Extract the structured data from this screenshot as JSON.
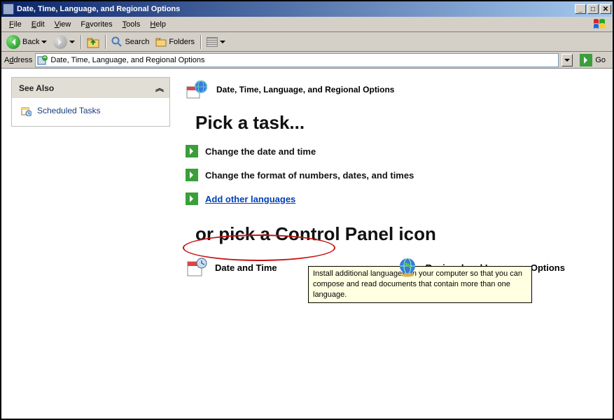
{
  "window": {
    "title": "Date, Time, Language, and Regional Options"
  },
  "menubar": {
    "file": "File",
    "edit": "Edit",
    "view": "View",
    "favorites": "Favorites",
    "tools": "Tools",
    "help": "Help"
  },
  "toolbar": {
    "back": "Back",
    "search": "Search",
    "folders": "Folders"
  },
  "addressbar": {
    "label": "Address",
    "value": "Date, Time, Language, and Regional Options",
    "go": "Go"
  },
  "sidepanel": {
    "see_also": {
      "title": "See Also",
      "items": [
        {
          "label": "Scheduled Tasks"
        }
      ]
    }
  },
  "main": {
    "category_title": "Date, Time, Language, and Regional Options",
    "heading_task": "Pick a task...",
    "tasks": [
      {
        "label": "Change the date and time"
      },
      {
        "label": "Change the format of numbers, dates, and times"
      },
      {
        "label": "Add other languages",
        "link": true
      }
    ],
    "heading_cpl": "or pick a Control Panel icon",
    "cpl_items": [
      {
        "label": "Date and Time"
      },
      {
        "label": "Regional and Language Options"
      }
    ],
    "tooltip": "Install additional languages on your computer so that you can compose and read documents that contain more than one language."
  }
}
